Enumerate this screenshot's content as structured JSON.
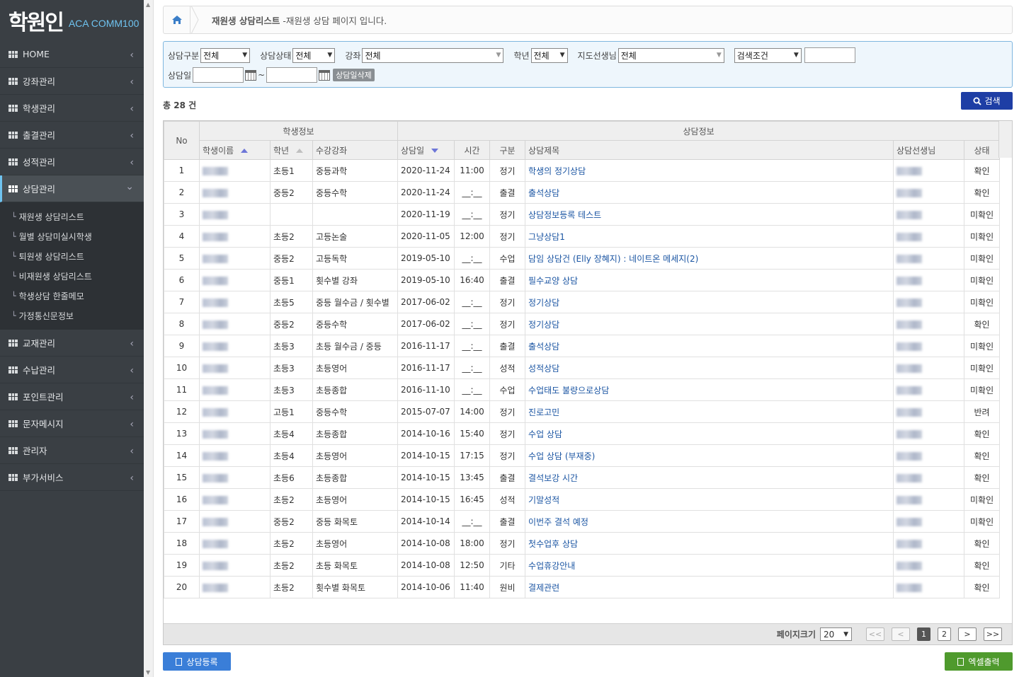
{
  "logo": {
    "mark": "학원인",
    "text": "ACA COMM100"
  },
  "nav": [
    {
      "label": "HOME"
    },
    {
      "label": "강좌관리"
    },
    {
      "label": "학생관리"
    },
    {
      "label": "출결관리"
    },
    {
      "label": "성적관리"
    },
    {
      "label": "상담관리"
    }
  ],
  "submenu": [
    "재원생 상담리스트",
    "월별 상담미실시학생",
    "퇴원생 상담리스트",
    "비재원생 상담리스트",
    "학생상담 한줄메모",
    "가정통신문정보"
  ],
  "nav_after": [
    {
      "label": "교재관리"
    },
    {
      "label": "수납관리"
    },
    {
      "label": "포인트관리"
    },
    {
      "label": "문자메시지"
    },
    {
      "label": "관리자"
    },
    {
      "label": "부가서비스"
    }
  ],
  "breadcrumb": {
    "title": "재원생 상담리스트",
    "desc": "-재원생 상담 페이지 입니다."
  },
  "filters": {
    "type_label": "상담구분",
    "type_value": "전체",
    "status_label": "상담상태",
    "status_value": "전체",
    "course_label": "강좌",
    "course_value": "전체",
    "grade_label": "학년",
    "grade_value": "전체",
    "teacher_label": "지도선생님",
    "teacher_value": "전체",
    "cond_value": "검색조건",
    "date_label": "상담일",
    "tilde": "~",
    "del_label": "상담일삭제"
  },
  "total": "총 28 건",
  "search_label": "검색",
  "table": {
    "group_no": "No",
    "group_student": "학생정보",
    "group_consult": "상담정보",
    "cols": [
      "학생이름",
      "학년",
      "수강강좌",
      "상담일",
      "시간",
      "구분",
      "상담제목",
      "상담선생님",
      "상태"
    ],
    "rows": [
      [
        "1",
        "초등1",
        "중등과학",
        "2020-11-24",
        "11:00",
        "정기",
        "학생의 정기상담",
        "확인"
      ],
      [
        "2",
        "중등2",
        "중등수학",
        "2020-11-24",
        "__:__",
        "출결",
        "출석상담",
        "확인"
      ],
      [
        "3",
        "",
        "",
        "2020-11-19",
        "__:__",
        "정기",
        "상담정보등록 테스트",
        "미확인"
      ],
      [
        "4",
        "초등2",
        "고등논술",
        "2020-11-05",
        "12:00",
        "정기",
        "그냥상담1",
        "미확인"
      ],
      [
        "5",
        "중등2",
        "고등독학",
        "2019-05-10",
        "__:__",
        "수업",
        "담임 상담건 (Elly 장혜지) : 네이트온 메세지(2)",
        "미확인"
      ],
      [
        "6",
        "중등1",
        "횟수별 강좌",
        "2019-05-10",
        "16:40",
        "출결",
        "필수교양 상담",
        "미확인"
      ],
      [
        "7",
        "초등5",
        "중등 월수금 / 횟수별",
        "2017-06-02",
        "__:__",
        "정기",
        "정기상담",
        "미확인"
      ],
      [
        "8",
        "중등2",
        "중등수학",
        "2017-06-02",
        "__:__",
        "정기",
        "정기상담",
        "확인"
      ],
      [
        "9",
        "초등3",
        "초등 월수금 / 중등",
        "2016-11-17",
        "__:__",
        "출결",
        "출석상담",
        "미확인"
      ],
      [
        "10",
        "초등3",
        "초등영어",
        "2016-11-17",
        "__:__",
        "성적",
        "성적상담",
        "미확인"
      ],
      [
        "11",
        "초등3",
        "초등종합",
        "2016-11-10",
        "__:__",
        "수업",
        "수업태도 불량으로상담",
        "미확인"
      ],
      [
        "12",
        "고등1",
        "중등수학",
        "2015-07-07",
        "14:00",
        "정기",
        "진로고민",
        "반려"
      ],
      [
        "13",
        "초등4",
        "초등종합",
        "2014-10-16",
        "15:40",
        "정기",
        "수업 상담",
        "확인"
      ],
      [
        "14",
        "초등4",
        "초등영어",
        "2014-10-15",
        "17:15",
        "정기",
        "수업 상담 (부재중)",
        "확인"
      ],
      [
        "15",
        "초등6",
        "초등종합",
        "2014-10-15",
        "13:45",
        "출결",
        "결석보강 시간",
        "확인"
      ],
      [
        "16",
        "초등2",
        "초등영어",
        "2014-10-15",
        "16:45",
        "성적",
        "기말성적",
        "미확인"
      ],
      [
        "17",
        "중등2",
        "중등 화목토",
        "2014-10-14",
        "__:__",
        "출결",
        "이번주 결석 예정",
        "미확인"
      ],
      [
        "18",
        "초등2",
        "초등영어",
        "2014-10-08",
        "18:00",
        "정기",
        "첫수업후 상담",
        "확인"
      ],
      [
        "19",
        "초등2",
        "초등 화목토",
        "2014-10-08",
        "12:50",
        "기타",
        "수업휴강안내",
        "확인"
      ],
      [
        "20",
        "초등2",
        "횟수별 화목토",
        "2014-10-06",
        "11:40",
        "원비",
        "결제관련",
        "확인"
      ]
    ]
  },
  "pager": {
    "size_label": "페이지크기",
    "size_value": "20",
    "first": "<<",
    "prev": "<",
    "next": ">",
    "last": ">>",
    "pages": [
      "1",
      "2"
    ]
  },
  "register_label": "상담등록",
  "excel_label": "엑셀출력",
  "colors": {
    "sidebar": "#3a3f44",
    "link": "#1c56a3",
    "search": "#1e3ea5",
    "register": "#3a7ed8",
    "excel": "#4f9a2d"
  }
}
